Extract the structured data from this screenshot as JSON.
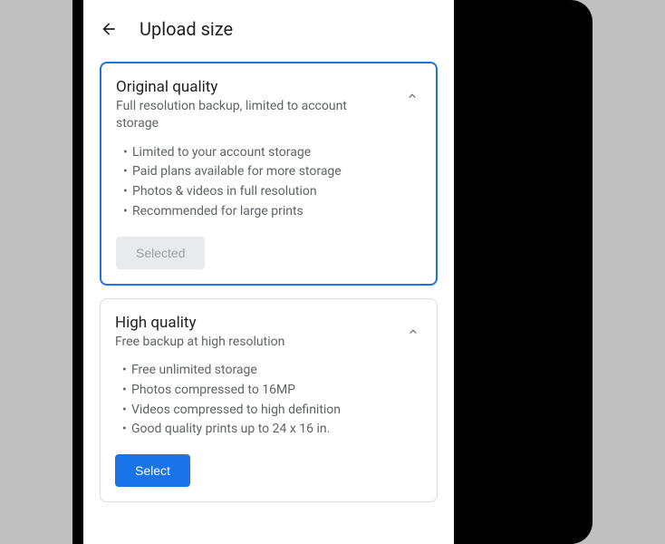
{
  "header": {
    "title": "Upload size"
  },
  "cards": [
    {
      "title": "Original quality",
      "subtitle": "Full resolution backup, limited to account storage",
      "bullets": [
        "Limited to your account storage",
        "Paid plans available for more storage",
        "Photos & videos in full resolution",
        "Recommended for large prints"
      ],
      "button": "Selected"
    },
    {
      "title": "High quality",
      "subtitle": "Free backup at high resolution",
      "bullets": [
        "Free unlimited storage",
        "Photos compressed to 16MP",
        "Videos compressed to high definition",
        "Good quality prints up to 24 x 16 in."
      ],
      "button": "Select"
    }
  ]
}
